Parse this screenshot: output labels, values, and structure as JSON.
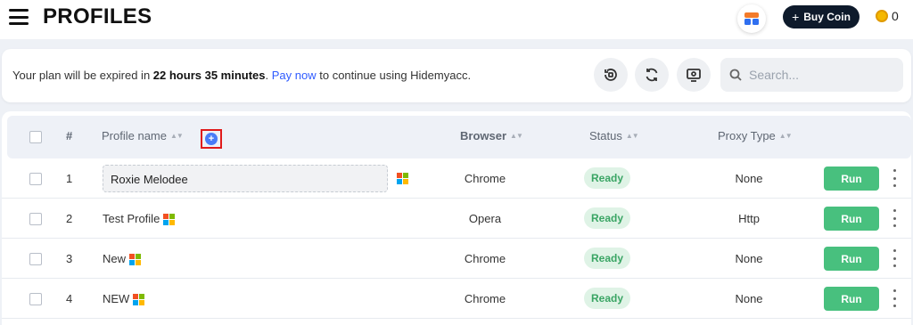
{
  "header": {
    "title": "PROFILES",
    "buy_coin_label": "Buy Coin",
    "coin_balance": "0"
  },
  "plan": {
    "prefix": "Your plan will be expired in ",
    "remaining": "22 hours 35 minutes",
    "period": ".",
    "pay_link": "Pay now",
    "suffix": " to continue using Hidemyacc."
  },
  "search": {
    "placeholder": "Search..."
  },
  "table": {
    "columns": {
      "index": "#",
      "profile_name": "Profile name",
      "browser": "Browser",
      "status": "Status",
      "proxy_type": "Proxy Type"
    },
    "rows": [
      {
        "index": "1",
        "name": "Roxie Melodee",
        "os": "windows",
        "browser": "Chrome",
        "status": "Ready",
        "proxy": "None",
        "action": "Run"
      },
      {
        "index": "2",
        "name": "Test Profile",
        "os": "windows",
        "browser": "Opera",
        "status": "Ready",
        "proxy": "Http",
        "action": "Run"
      },
      {
        "index": "3",
        "name": "New",
        "os": "windows",
        "browser": "Chrome",
        "status": "Ready",
        "proxy": "None",
        "action": "Run"
      },
      {
        "index": "4",
        "name": "NEW",
        "os": "windows",
        "browser": "Chrome",
        "status": "Ready",
        "proxy": "None",
        "action": "Run"
      }
    ]
  },
  "colors": {
    "accent_blue": "#2f5bff",
    "run_green": "#48c07e",
    "ready_bg": "#dff3e6",
    "ready_text": "#3aa564",
    "buy_coin_bg": "#0e1a2b"
  },
  "icons": {
    "menu": "hamburger-menu-icon",
    "app": "app-logo-icon",
    "coin": "coin-icon",
    "history": "restore-icon",
    "refresh": "refresh-icon",
    "monitor": "monitor-icon",
    "search": "search-icon",
    "add_column": "plus-circle-icon",
    "os": "windows-icon",
    "more": "more-vertical-icon"
  }
}
